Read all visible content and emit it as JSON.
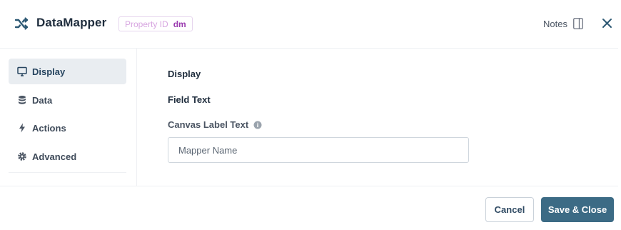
{
  "header": {
    "title": "DataMapper",
    "property_id_label": "Property ID",
    "property_id_value": "dm",
    "notes_label": "Notes"
  },
  "sidebar": {
    "items": [
      {
        "label": "Display",
        "icon": "monitor-icon",
        "active": true
      },
      {
        "label": "Data",
        "icon": "database-icon",
        "active": false
      },
      {
        "label": "Actions",
        "icon": "lightning-bolt-icon",
        "active": false
      },
      {
        "label": "Advanced",
        "icon": "gear-icon",
        "active": false
      }
    ]
  },
  "main": {
    "section_title": "Display",
    "subsection_title": "Field Text",
    "canvas_label": "Canvas Label Text",
    "canvas_input": {
      "value": "",
      "placeholder": "Mapper Name"
    }
  },
  "footer": {
    "cancel_label": "Cancel",
    "save_label": "Save & Close"
  },
  "colors": {
    "accent": "#3c6b85",
    "title": "#1f2d3d",
    "active_item_bg": "#e9edf1",
    "property_id_value": "#9b3cb0"
  }
}
